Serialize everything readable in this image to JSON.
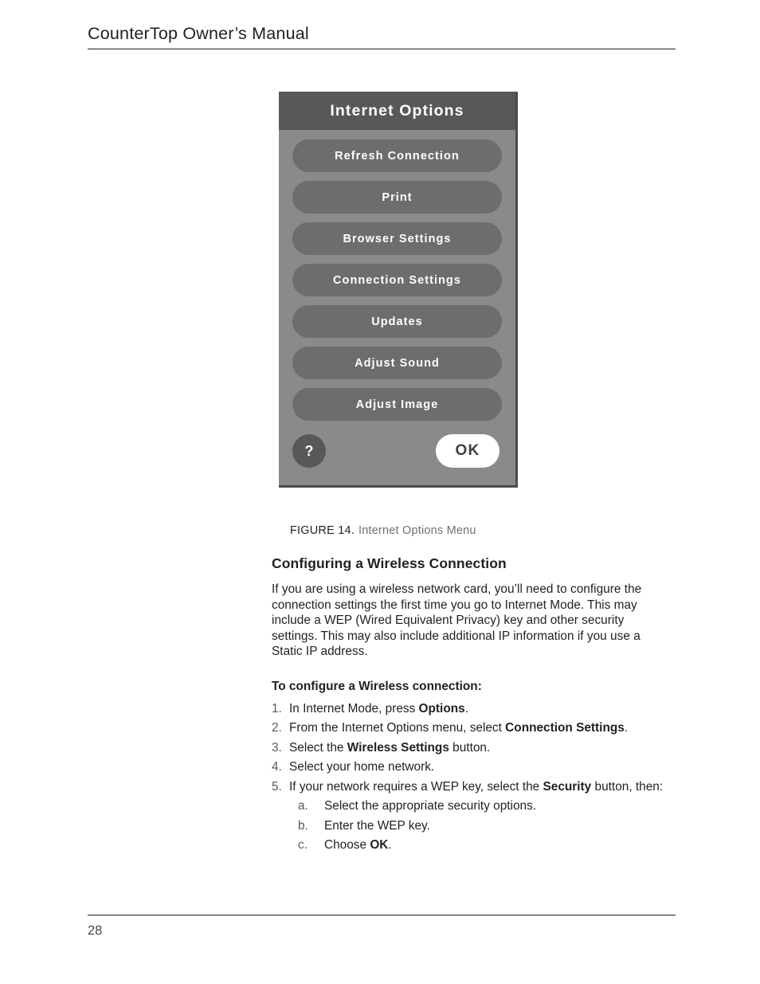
{
  "header": {
    "title": "CounterTop Owner’s Manual"
  },
  "figure": {
    "dialog": {
      "title": "Internet Options",
      "menu_buttons": [
        {
          "label": "Refresh Connection"
        },
        {
          "label": "Print"
        },
        {
          "label": "Browser Settings"
        },
        {
          "label": "Connection Settings"
        },
        {
          "label": "Updates"
        },
        {
          "label": "Adjust Sound"
        },
        {
          "label": "Adjust Image"
        }
      ],
      "help_label": "?",
      "ok_label": "OK",
      "colors": {
        "titlebar": "#58585a",
        "body": "#8a8a8a",
        "button": "#6d6d6d",
        "button_text": "#ffffff",
        "ok_background": "#ffffff",
        "ok_text": "#3f3f41"
      }
    },
    "caption_label": "FIGURE 14.",
    "caption_text": "Internet Options Menu"
  },
  "content": {
    "section_heading": "Configuring a Wireless Connection",
    "paragraph": "If you are using a wireless network card, you’ll need to configure the connection settings the first time you go to Internet Mode. This may include a WEP (Wired Equivalent Privacy) key and other security settings. This may also include additional IP information if you use a Static IP address.",
    "procedure_heading": "To configure a Wireless connection:",
    "steps": [
      {
        "marker": "1.",
        "parts": [
          {
            "text": "In Internet Mode, press ",
            "bold": false
          },
          {
            "text": "Options",
            "bold": true
          },
          {
            "text": ".",
            "bold": false
          }
        ]
      },
      {
        "marker": "2.",
        "parts": [
          {
            "text": "From the Internet Options menu, select ",
            "bold": false
          },
          {
            "text": "Connection Settings",
            "bold": true
          },
          {
            "text": ".",
            "bold": false
          }
        ]
      },
      {
        "marker": "3.",
        "parts": [
          {
            "text": "Select the  ",
            "bold": false
          },
          {
            "text": "Wireless Settings",
            "bold": true
          },
          {
            "text": " button.",
            "bold": false
          }
        ]
      },
      {
        "marker": "4.",
        "parts": [
          {
            "text": "Select your home network.",
            "bold": false
          }
        ]
      },
      {
        "marker": "5.",
        "parts": [
          {
            "text": "If your network requires a WEP key, select the ",
            "bold": false
          },
          {
            "text": "Security",
            "bold": true
          },
          {
            "text": " button, then:",
            "bold": false
          }
        ],
        "substeps": [
          {
            "marker": "a.",
            "parts": [
              {
                "text": "Select the appropriate security options.",
                "bold": false
              }
            ]
          },
          {
            "marker": "b.",
            "parts": [
              {
                "text": "Enter the WEP key.",
                "bold": false
              }
            ]
          },
          {
            "marker": "c.",
            "parts": [
              {
                "text": "Choose ",
                "bold": false
              },
              {
                "text": "OK",
                "bold": true
              },
              {
                "text": ".",
                "bold": false
              }
            ]
          }
        ]
      }
    ]
  },
  "footer": {
    "page_number": "28"
  }
}
